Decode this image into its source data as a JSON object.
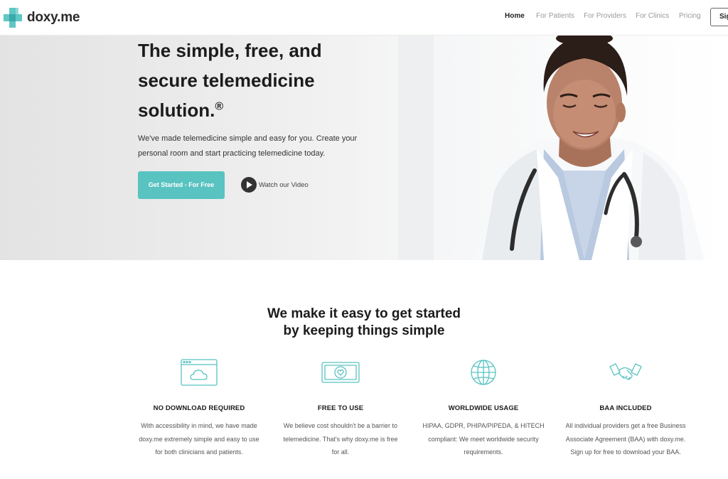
{
  "brand": {
    "name": "doxy.me",
    "accent_color": "#58c3c1",
    "logo_icon": "medical-cross-icon"
  },
  "nav": {
    "items": [
      {
        "label": "Home",
        "active": true
      },
      {
        "label": "For Patients",
        "active": false
      },
      {
        "label": "For Providers",
        "active": false
      },
      {
        "label": "For Clinics",
        "active": false
      },
      {
        "label": "Pricing",
        "active": false
      }
    ],
    "signin_label": "Sig"
  },
  "hero": {
    "title": "The simple, free, and\nsecure telemedicine\nsolution.",
    "title_mark": "®",
    "subtitle": "We've made telemedicine simple and easy for you. Create your personal room and start practicing telemedicine today.",
    "cta_label": "Get Started - For Free",
    "video_label": "Watch our Video"
  },
  "features_section": {
    "title_line1": "We make it easy to get started",
    "title_line2": "by keeping things simple",
    "items": [
      {
        "icon": "browser-cloud-icon",
        "title": "NO DOWNLOAD REQUIRED",
        "text": "With accessibility in mind, we have made doxy.me extremely simple and easy to use for both clinicians and patients."
      },
      {
        "icon": "heart-banknote-icon",
        "title": "FREE TO USE",
        "text": "We believe cost shouldn't be a barrier to telemedicine. That's why doxy.me is free for all."
      },
      {
        "icon": "globe-icon",
        "title": "WORLDWIDE USAGE",
        "text": "HIPAA, GDPR, PHIPA/PIPEDA, & HITECH compliant: We meet worldwide security requirements."
      },
      {
        "icon": "handshake-icon",
        "title": "BAA INCLUDED",
        "text": "All individual providers get a free Business Associate Agreement (BAA) with doxy.me. Sign up for free to download your BAA."
      }
    ]
  }
}
